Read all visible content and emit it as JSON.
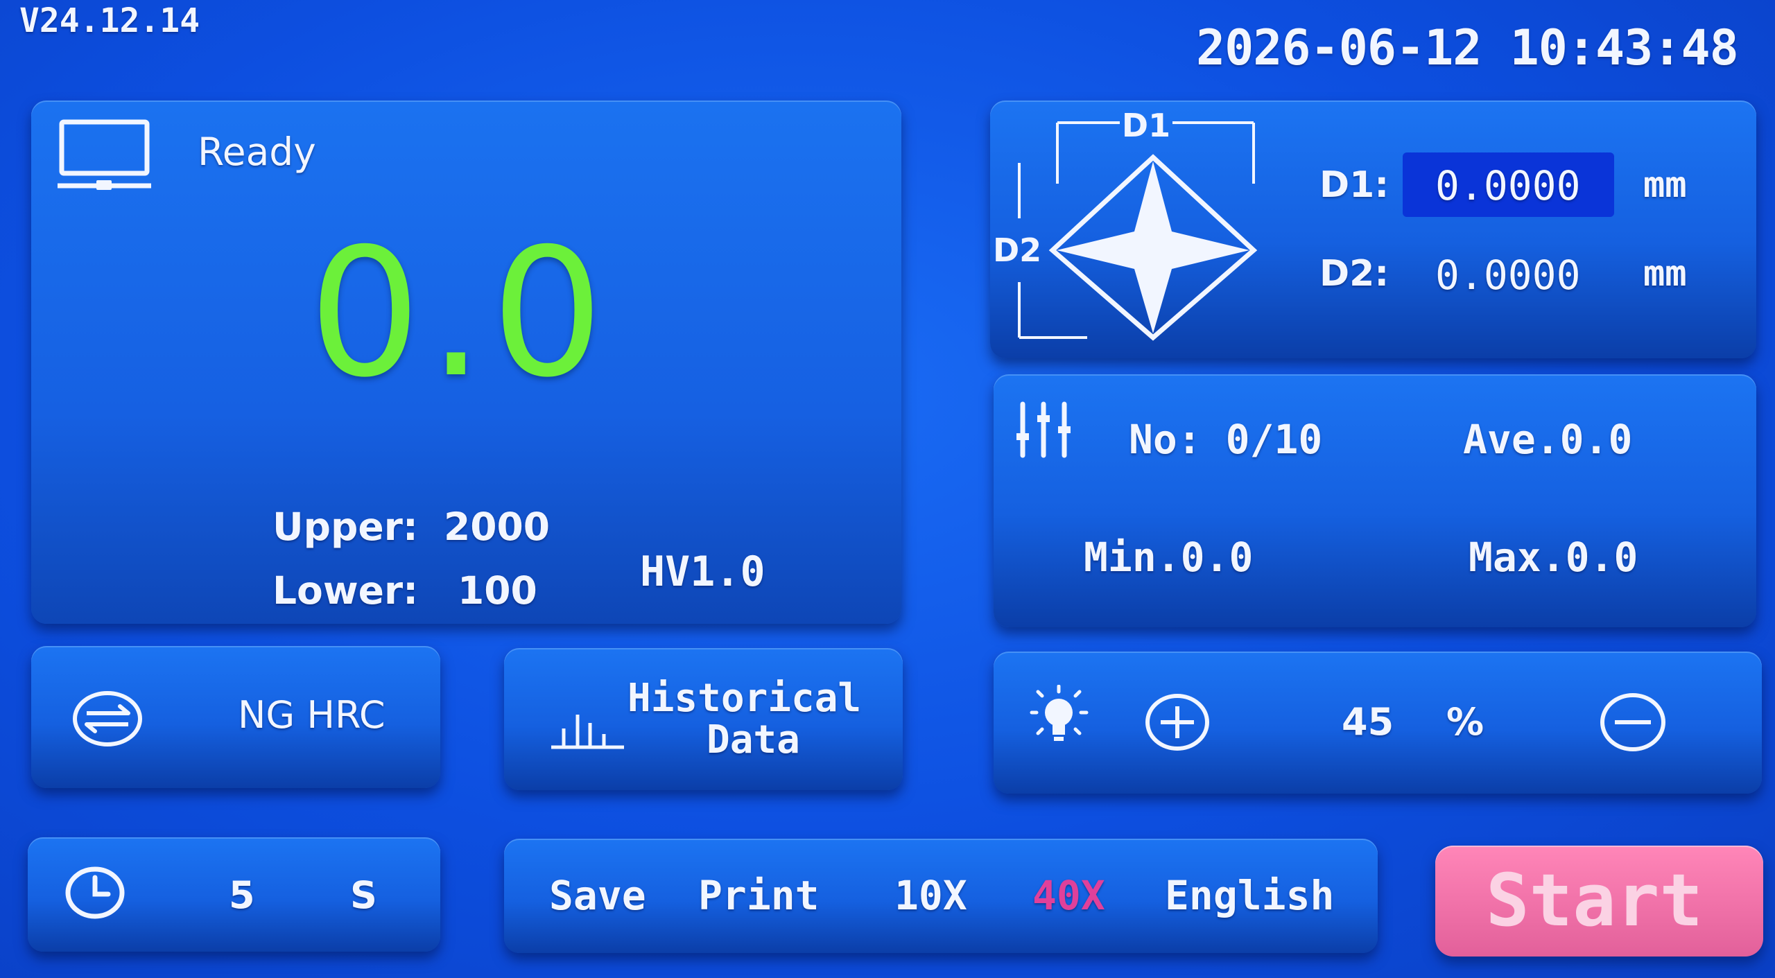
{
  "header": {
    "version": "V24.12.14",
    "datetime": "2026-06-12  10:43:48"
  },
  "status_panel": {
    "status": "Ready",
    "reading": "0.0",
    "upper_label": "Upper:",
    "upper_value": "2000",
    "lower_label": "Lower:",
    "lower_value": "100",
    "scale": "HV1.0",
    "reading_color": "#6cf03a"
  },
  "diagonal_panel": {
    "diagram_d1": "D1",
    "diagram_d2": "D2",
    "d1_label": "D1:",
    "d1_value": "0.0000",
    "d1_unit": "mm",
    "d2_label": "D2:",
    "d2_value": "0.0000",
    "d2_unit": "mm",
    "active_field_color": "#0a34d8"
  },
  "stats_panel": {
    "no": "No: 0/10",
    "ave": "Ave.0.0",
    "min": "Min.0.0",
    "max": "Max.0.0"
  },
  "convert_button": {
    "label": "NG HRC",
    "icon": "convert-arrows-icon"
  },
  "history_button": {
    "label_line1": "Historical",
    "label_line2": "Data",
    "icon": "bar-chart-icon"
  },
  "light_panel": {
    "icon": "light-bulb-icon",
    "value": "45",
    "unit": "%",
    "level": 45
  },
  "timer_panel": {
    "icon": "clock-icon",
    "value": "5",
    "unit": "S"
  },
  "toolbar": {
    "save": "Save",
    "print": "Print",
    "lens_10x": "10X",
    "lens_40x": "40X",
    "language": "English",
    "active_lens_color": "#e0409a"
  },
  "start_button": {
    "label": "Start",
    "color": "#ee6fa6"
  }
}
